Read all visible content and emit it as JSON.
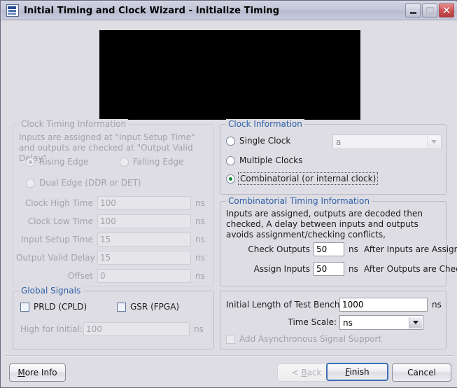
{
  "window": {
    "title": "Initial Timing and Clock Wizard - Initialize Timing",
    "icon": "ise-logo-icon",
    "minimize_tooltip": "Minimize",
    "maximize_tooltip": "Maximize",
    "close_glyph": "✕"
  },
  "preview": {
    "alt": "timing-waveform-preview",
    "color": "#000000"
  },
  "clock_timing": {
    "legend": "Clock Timing Information",
    "description": "Inputs are assigned at \"Input Setup Time\" and outputs are checked at \"Output Valid Delay\",",
    "radios": [
      {
        "label": "Rising Edge",
        "selected": true,
        "enabled": false
      },
      {
        "label": "Falling Edge",
        "selected": false,
        "enabled": false
      },
      {
        "label": "Dual Edge (DDR or DET)",
        "selected": false,
        "enabled": false
      }
    ],
    "fields": [
      {
        "label": "Clock High Time",
        "value": "100",
        "unit": "ns",
        "enabled": false
      },
      {
        "label": "Clock Low Time",
        "value": "100",
        "unit": "ns",
        "enabled": false
      },
      {
        "label": "Input Setup Time",
        "value": "15",
        "unit": "ns",
        "enabled": false
      },
      {
        "label": "Output Valid Delay",
        "value": "15",
        "unit": "ns",
        "enabled": false
      },
      {
        "label": "Offset",
        "value": "0",
        "unit": "ns",
        "enabled": false
      }
    ]
  },
  "clock_information": {
    "legend": "Clock Information",
    "radios": [
      {
        "label": "Single Clock",
        "selected": false
      },
      {
        "label": "Multiple Clocks",
        "selected": false
      },
      {
        "label": "Combinatorial (or internal clock)",
        "selected": true,
        "focused": true
      }
    ],
    "clock_select": {
      "value": "a",
      "enabled": false,
      "options": [
        "a"
      ]
    }
  },
  "combinatorial_timing": {
    "legend": "Combinatorial Timing Information",
    "description": "Inputs are assigned, outputs are decoded then checked,  A delay between inputs and outputs avoids assignment/checking conflicts,",
    "rows": [
      {
        "label": "Check Outputs",
        "value": "50",
        "unit": "ns",
        "suffix": "After Inputs are Assigned"
      },
      {
        "label": "Assign Inputs",
        "value": "50",
        "unit": "ns",
        "suffix": "After Outputs are Checked"
      }
    ]
  },
  "global_signals": {
    "legend": "Global Signals",
    "checkboxes": [
      {
        "label": "PRLD (CPLD)",
        "checked": false,
        "enabled": true
      },
      {
        "label": "GSR (FPGA)",
        "checked": false,
        "enabled": true
      }
    ],
    "high_for_initial": {
      "label": "High for Initial:",
      "value": "100",
      "unit": "ns",
      "enabled": false
    }
  },
  "testbench": {
    "length_label": "Initial Length of Test Bench:",
    "length_value": "1000",
    "length_unit": "ns",
    "time_scale_label": "Time Scale:",
    "time_scale_value": "ns",
    "time_scale_options": [
      "ns"
    ],
    "async_label": "Add Asynchronous Signal Support",
    "async_checked": false,
    "async_enabled": false
  },
  "buttons": {
    "more_info": {
      "label": "More Info",
      "mnemonic": "M",
      "enabled": true
    },
    "back": {
      "label": "< Back",
      "mnemonic": "B",
      "enabled": false
    },
    "finish": {
      "label": "Finish",
      "mnemonic": "F",
      "enabled": true,
      "default": true
    },
    "cancel": {
      "label": "Cancel",
      "enabled": true
    }
  },
  "colors": {
    "dialog_bg": "#dedde3",
    "legend_blue": "#2d5fa8",
    "disabled_text": "#a2a2ab",
    "default_button_border": "#3b6fb5",
    "radio_dot_green": "#0f8a2f"
  }
}
